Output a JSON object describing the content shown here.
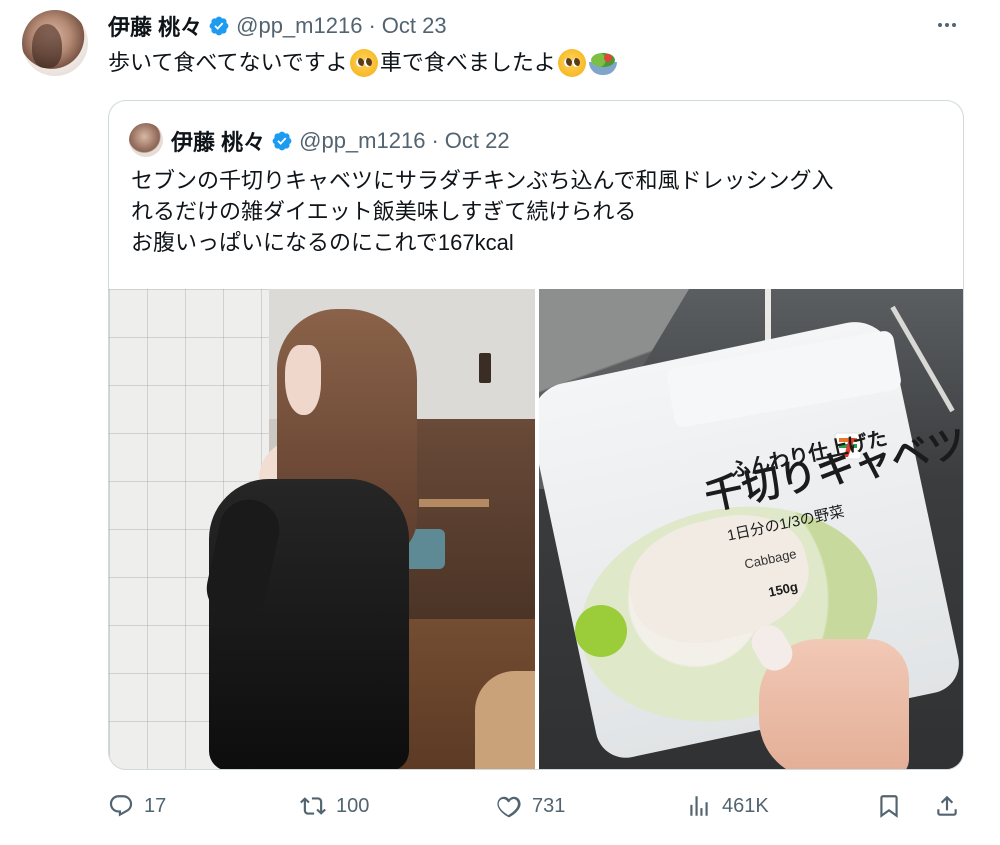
{
  "tweet": {
    "author_name": "伊藤 桃々",
    "handle": "@pp_m1216",
    "separator": "·",
    "date": "Oct 23",
    "text_part1": "歩いて食べてないですよ",
    "text_part2": "車で食べましたよ",
    "emojis": [
      "pleading-face",
      "pleading-face",
      "salad"
    ]
  },
  "quote": {
    "author_name": "伊藤 桃々",
    "handle": "@pp_m1216",
    "separator": "·",
    "date": "Oct 22",
    "lines": [
      "セブンの千切りキャベツにサラダチキンぶち込んで和風ドレッシング入",
      "れるだけの雑ダイエット飯美味しすぎて続けられる",
      "お腹いっぱいになるのにこれで167kcal"
    ],
    "package": {
      "sub": "ふんわり仕上げた",
      "title": "千切りキャベツ",
      "small": "1日分の1/3の野菜",
      "english": "Cabbage",
      "weight": "150g"
    }
  },
  "actions": {
    "replies": "17",
    "retweets": "100",
    "likes": "731",
    "views": "461K"
  },
  "colors": {
    "verified": "#1d9bf0",
    "muted_text": "#536471",
    "border": "#cfd9de"
  }
}
